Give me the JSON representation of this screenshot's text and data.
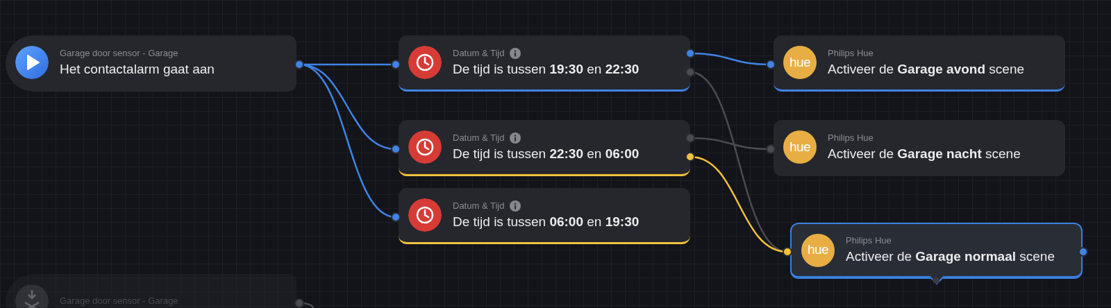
{
  "triggers": [
    {
      "device": "Garage door sensor - Garage",
      "text": "Het contactalarm gaat aan",
      "disabled": false
    },
    {
      "device": "Garage door sensor - Garage",
      "disabled": true
    }
  ],
  "conditions": [
    {
      "app": "Datum & Tijd",
      "text": "De tijd is tussen **19:30** en **22:30**",
      "color": "#3f83e4"
    },
    {
      "app": "Datum & Tijd",
      "text": "De tijd is tussen **22:30** en **06:00**",
      "color": "#f2c13c"
    },
    {
      "app": "Datum & Tijd",
      "text": "De tijd is tussen **06:00** en **19:30**",
      "color": "#f2c13c"
    }
  ],
  "actions": [
    {
      "app": "Philips Hue",
      "logo": "hue",
      "text": "Activeer de **Garage avond** scene",
      "color": "#3f83e4",
      "selected": false
    },
    {
      "app": "Philips Hue",
      "logo": "hue",
      "text": "Activeer de **Garage nacht** scene",
      "selected": false
    },
    {
      "app": "Philips Hue",
      "logo": "hue",
      "text": "Activeer de **Garage normaal** scene",
      "selected": true
    }
  ]
}
